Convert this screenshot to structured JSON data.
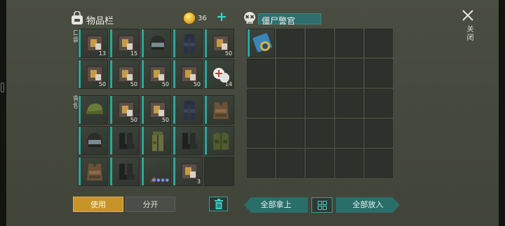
{
  "inventory": {
    "title": "物品栏",
    "coins": "36",
    "plus_label": "+",
    "pocket_label": "口袋",
    "backpack_label": "背包"
  },
  "pocket": [
    {
      "icon": "book-icon",
      "count": "13"
    },
    {
      "icon": "book-icon",
      "count": "15"
    },
    {
      "icon": "helmet-icon",
      "count": ""
    },
    {
      "icon": "armor-pants-icon",
      "count": ""
    },
    {
      "icon": "book-icon",
      "count": "50"
    },
    {
      "icon": "book-icon",
      "count": "50"
    },
    {
      "icon": "book-icon",
      "count": "50"
    },
    {
      "icon": "book-icon",
      "count": "50"
    },
    {
      "icon": "book-icon",
      "count": "50"
    },
    {
      "icon": "medkit-icon",
      "count": "14"
    }
  ],
  "backpack": [
    {
      "icon": "cap-icon",
      "count": ""
    },
    {
      "icon": "book-icon",
      "count": "50"
    },
    {
      "icon": "book-icon",
      "count": "50"
    },
    {
      "icon": "armor-pants-icon",
      "count": ""
    },
    {
      "icon": "vest-icon",
      "count": ""
    },
    {
      "icon": "helmet-icon",
      "count": ""
    },
    {
      "icon": "boots-icon",
      "count": ""
    },
    {
      "icon": "pants-icon",
      "count": ""
    },
    {
      "icon": "boots-icon",
      "count": ""
    },
    {
      "icon": "jacket-icon",
      "count": ""
    },
    {
      "icon": "vest-icon",
      "count": ""
    },
    {
      "icon": "boots-icon",
      "count": ""
    },
    {
      "icon": "shotgun-icon",
      "count": "",
      "dots": "●●●●"
    },
    {
      "icon": "book-icon",
      "count": "3"
    },
    {
      "icon": "",
      "count": ""
    }
  ],
  "loot": {
    "title": "僵尸警官",
    "first_item_icon": "police-badge-icon"
  },
  "buttons": {
    "use": "使用",
    "split": "分开",
    "take_all": "全部拿上",
    "put_all": "全部放入",
    "close": "关闭"
  },
  "colors": {
    "accent": "#2fa6a0",
    "use_button": "#c7942a",
    "background": "#4a4d41"
  }
}
